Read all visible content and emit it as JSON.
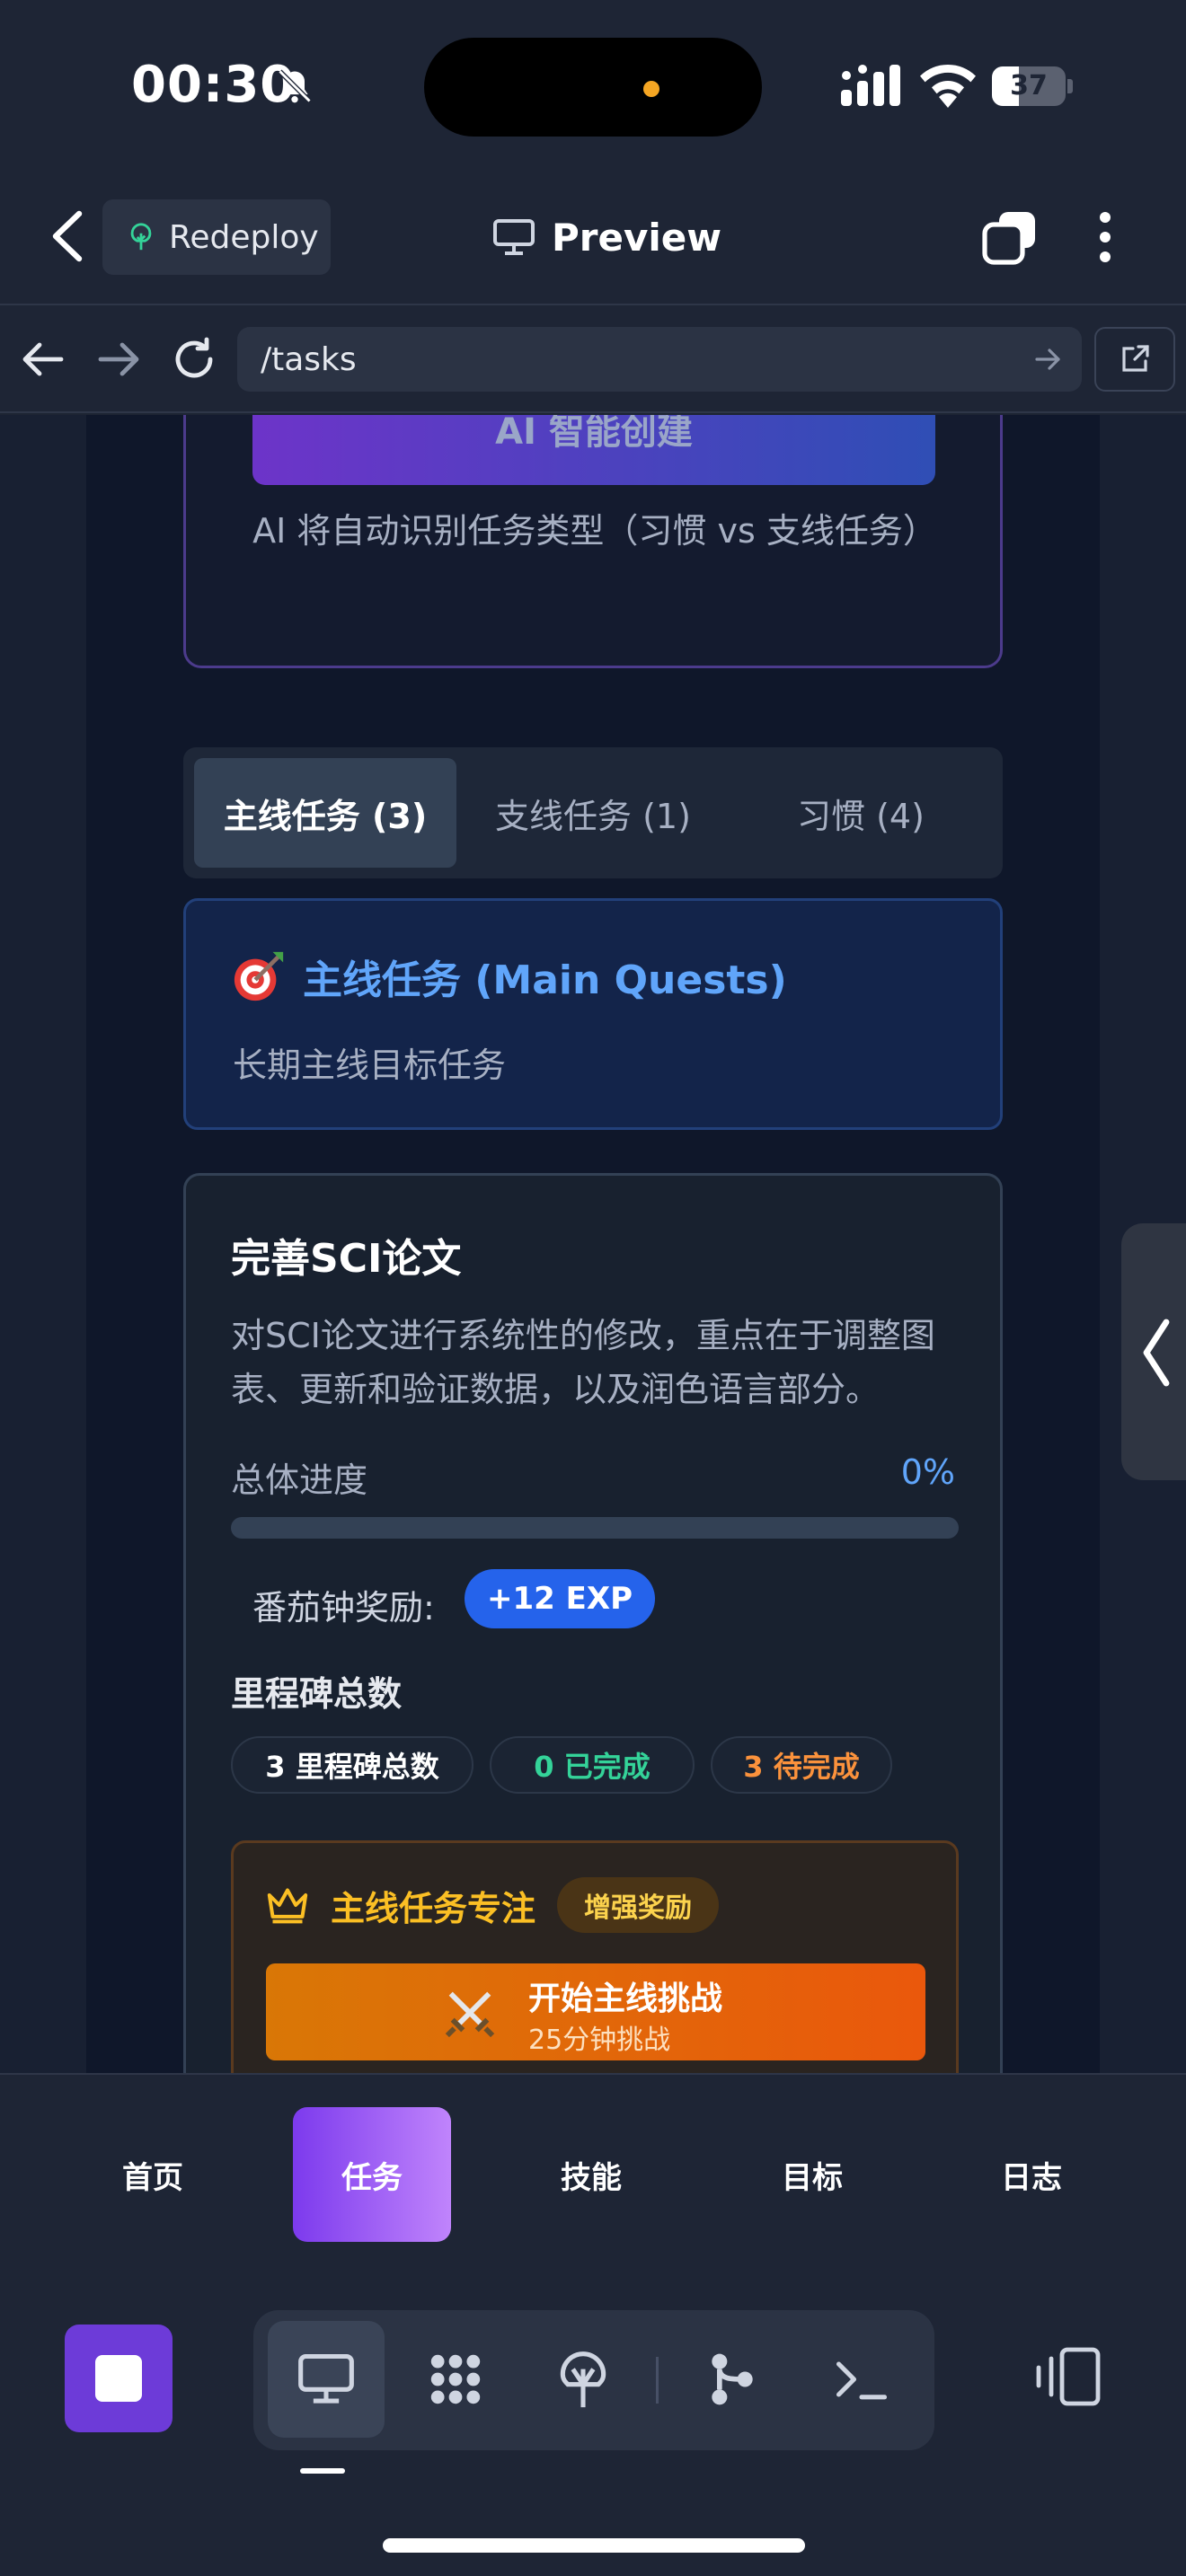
{
  "status_bar": {
    "time": "00:30",
    "battery": "37",
    "battery_level": 0.37
  },
  "header": {
    "redeploy_label": "Redeploy",
    "title": "Preview"
  },
  "urlbar": {
    "url": "/tasks"
  },
  "ai_section": {
    "button_label": "AI 智能创建",
    "hint": "AI 将自动识别任务类型（习惯 vs 支线任务）"
  },
  "tabs": [
    {
      "label": "主线任务 (3)",
      "active": true
    },
    {
      "label": "支线任务 (1)",
      "active": false
    },
    {
      "label": "习惯 (4)",
      "active": false
    }
  ],
  "banner": {
    "title": "主线任务 (Main Quests)",
    "subtitle": "长期主线目标任务"
  },
  "task": {
    "title": "完善SCI论文",
    "description": "对SCI论文进行系统性的修改，重点在于调整图表、更新和验证数据，以及润色语言部分。",
    "progress_label": "总体进度",
    "progress_value": "0%",
    "progress_fraction": 0,
    "reward_label": "番茄钟奖励:",
    "reward_badge": "+12 EXP",
    "milestones_title": "里程碑总数",
    "chips": [
      {
        "label": "3 里程碑总数",
        "color": "#ffffff"
      },
      {
        "label": "0 已完成",
        "color": "#34d399"
      },
      {
        "label": "3 待完成",
        "color": "#fb923c"
      }
    ],
    "focus": {
      "title": "主线任务专注",
      "badge": "增强奖励",
      "start_label": "开始主线挑战",
      "start_sub": "25分钟挑战"
    }
  },
  "app_nav": [
    {
      "label": "首页",
      "active": false
    },
    {
      "label": "任务",
      "active": true
    },
    {
      "label": "技能",
      "active": false
    },
    {
      "label": "目标",
      "active": false
    },
    {
      "label": "日志",
      "active": false
    }
  ],
  "colors": {
    "accent_blue": "#60a5fa",
    "accent_purple": "#7c3aed",
    "accent_orange": "#ea580c",
    "gold": "#fbbf24"
  },
  "icons": [
    "chevron-left-icon",
    "tree-icon",
    "monitor-icon",
    "copy-icon",
    "more-icon",
    "arrow-left-icon",
    "arrow-right-icon",
    "reload-icon",
    "external-link-icon",
    "target-icon",
    "crown-icon",
    "swords-icon",
    "stop-icon",
    "grid-dots-icon",
    "branch-icon",
    "terminal-icon",
    "panel-icon"
  ]
}
